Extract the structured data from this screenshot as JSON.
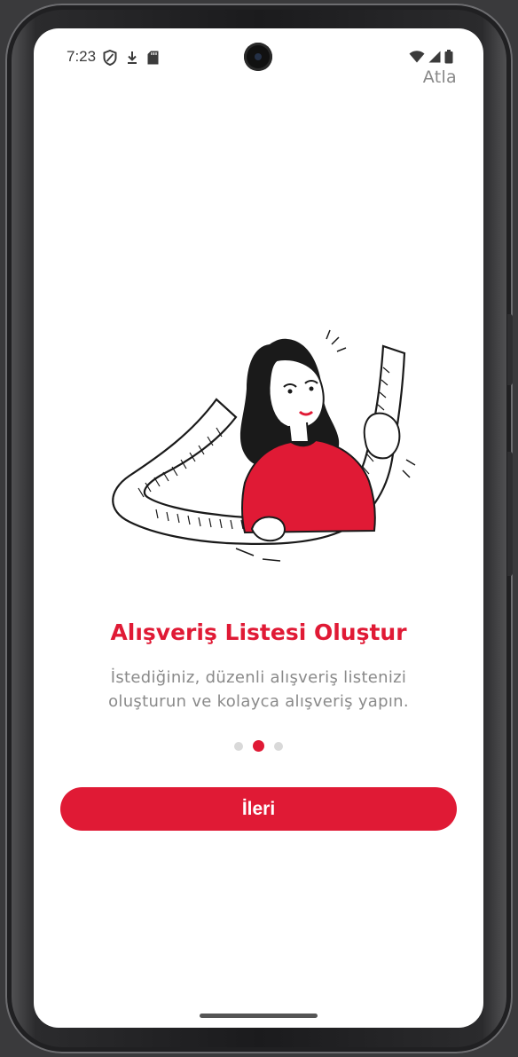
{
  "status_bar": {
    "time": "7:23",
    "left_icons": [
      "shield-icon",
      "download-arrow-icon",
      "sd-card-icon"
    ],
    "right_icons": [
      "wifi-icon",
      "signal-icon",
      "battery-icon"
    ]
  },
  "header": {
    "skip_label": "Atla"
  },
  "onboarding": {
    "illustration": "woman-holding-shopping-list-illustration",
    "title": "Alışveriş Listesi Oluştur",
    "description": "İstediğiniz, düzenli alışveriş listenizi oluşturun ve kolayca alışveriş yapın.",
    "page_count": 3,
    "active_page": 2,
    "next_label": "İleri"
  },
  "colors": {
    "accent": "#e01a35",
    "text_muted": "#8a8a8a",
    "dot_inactive": "#d9d9d9"
  }
}
